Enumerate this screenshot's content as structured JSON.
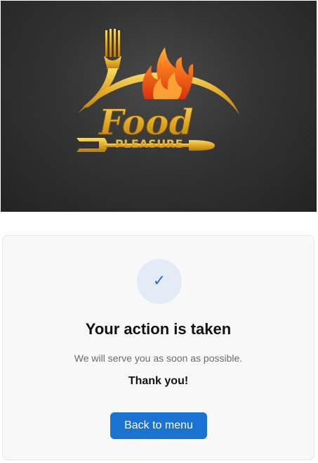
{
  "hero": {
    "logo": {
      "word": "Food",
      "tagline": "PLEASURE"
    }
  },
  "confirmation": {
    "icon": "checkmark-icon",
    "icon_glyph": "✓",
    "title": "Your action is taken",
    "message": "We will serve you as soon as possible.",
    "thanks": "Thank you!",
    "button_label": "Back to menu"
  },
  "colors": {
    "accent": "#1a73d1",
    "check_bg": "#e3ebf6",
    "logo_gold": "#e8b92e",
    "flame": "#f26a1b"
  }
}
